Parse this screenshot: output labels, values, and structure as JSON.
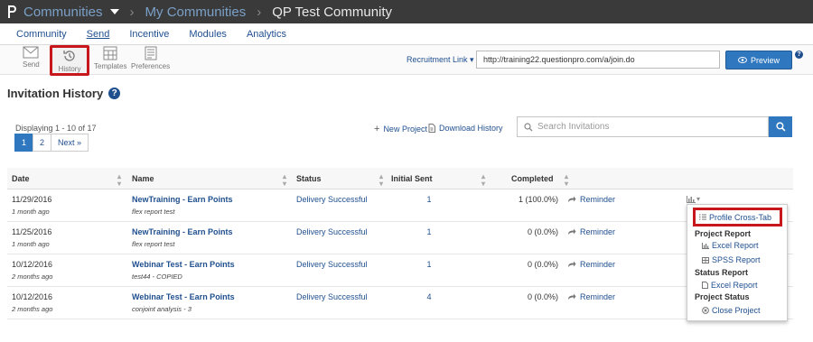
{
  "breadcrumb": {
    "communities": "Communities",
    "my_communities": "My Communities",
    "current": "QP Test Community"
  },
  "main_nav": [
    {
      "label": "Community"
    },
    {
      "label": "Send"
    },
    {
      "label": "Incentive"
    },
    {
      "label": "Modules"
    },
    {
      "label": "Analytics"
    }
  ],
  "toolbar": {
    "send": "Send",
    "history": "History",
    "templates": "Templates",
    "preferences": "Preferences",
    "recruitment_label": "Recruitment Link",
    "recruitment_value": "http://training22.questionpro.com/a/join.do",
    "preview": "Preview"
  },
  "page": {
    "title": "Invitation History",
    "displaying": "Displaying 1 - 10 of 17",
    "pager": [
      "1",
      "2",
      "Next »"
    ],
    "new_project": "New Project",
    "download_history": "Download History",
    "search_placeholder": "Search Invitations"
  },
  "table": {
    "headers": {
      "date": "Date",
      "name": "Name",
      "status": "Status",
      "initial_sent": "Initial Sent",
      "completed": "Completed"
    },
    "rows": [
      {
        "date": "11/29/2016",
        "ago": "1 month ago",
        "name": "NewTraining - Earn Points",
        "desc": "flex report test",
        "status": "Delivery Successful",
        "sent": "1",
        "completed": "1 (100.0%)",
        "reminder": "Reminder"
      },
      {
        "date": "11/25/2016",
        "ago": "1 month ago",
        "name": "NewTraining - Earn Points",
        "desc": "flex report test",
        "status": "Delivery Successful",
        "sent": "1",
        "completed": "0 (0.0%)",
        "reminder": "Reminder"
      },
      {
        "date": "10/12/2016",
        "ago": "2 months ago",
        "name": "Webinar Test - Earn Points",
        "desc": "test44 - COPIED",
        "status": "Delivery Successful",
        "sent": "1",
        "completed": "0 (0.0%)",
        "reminder": "Reminder"
      },
      {
        "date": "10/12/2016",
        "ago": "2 months ago",
        "name": "Webinar Test - Earn Points",
        "desc": "conjoint analysis - 3",
        "status": "Delivery Successful",
        "sent": "4",
        "completed": "0 (0.0%)",
        "reminder": "Reminder"
      }
    ]
  },
  "report_menu": {
    "profile_crosstab": "Profile Cross-Tab",
    "project_report": "Project Report",
    "excel_report": "Excel Report",
    "spss_report": "SPSS Report",
    "status_report": "Status Report",
    "status_excel_report": "Excel Report",
    "project_status": "Project Status",
    "close_project": "Close Project"
  },
  "colors": {
    "topbar": "#3a3a3a",
    "link": "#1f4f8f",
    "primary": "#2f78bf",
    "highlight": "#c8161d"
  }
}
